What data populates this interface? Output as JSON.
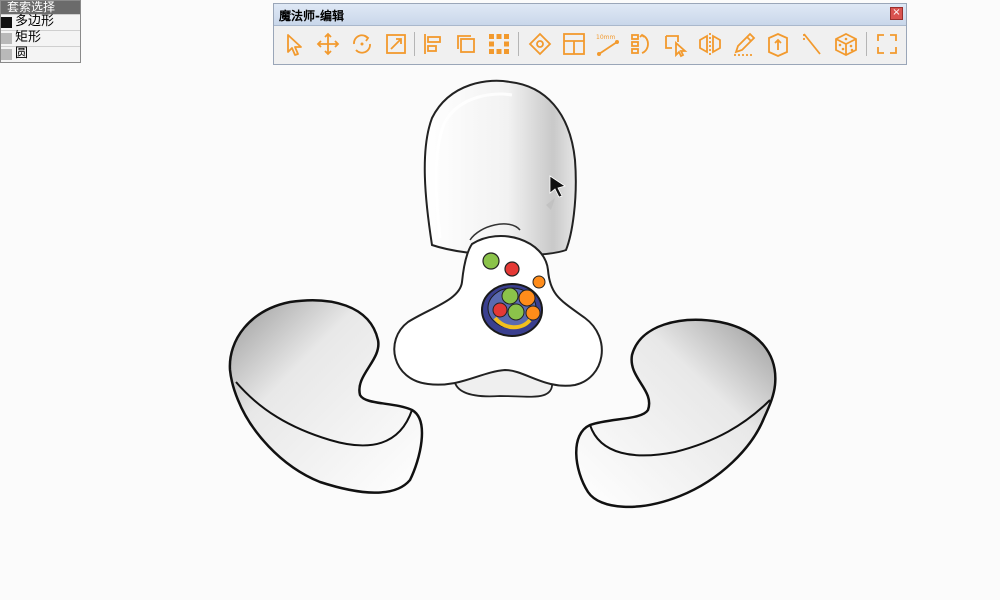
{
  "lasso_menu": {
    "title": "套索选择",
    "items": [
      {
        "label": "多边形",
        "swatch": "#111111"
      },
      {
        "label": "矩形",
        "swatch": "#b9b9b9"
      },
      {
        "label": "圆",
        "swatch": "#b9b9b9"
      }
    ]
  },
  "toolbar": {
    "title": "魔法师-编辑",
    "close_glyph": "×",
    "accent_color": "#f29a2e",
    "tools": [
      {
        "icon": "select-arrow-icon"
      },
      {
        "icon": "move-icon"
      },
      {
        "icon": "rotate-icon"
      },
      {
        "icon": "scale-icon"
      },
      {
        "icon": "align-icon"
      },
      {
        "icon": "layers-icon"
      },
      {
        "icon": "array-grid-icon"
      },
      {
        "icon": "snap-target-icon"
      },
      {
        "icon": "bounding-box-icon"
      },
      {
        "icon": "measure-icon",
        "label": "10mm"
      },
      {
        "icon": "distribute-icon"
      },
      {
        "icon": "select-group-icon"
      },
      {
        "icon": "mirror-icon"
      },
      {
        "icon": "pencil-icon"
      },
      {
        "icon": "push-pull-icon"
      },
      {
        "icon": "slope-icon"
      },
      {
        "icon": "dice-icon"
      },
      {
        "icon": "fullscreen-icon"
      }
    ]
  }
}
